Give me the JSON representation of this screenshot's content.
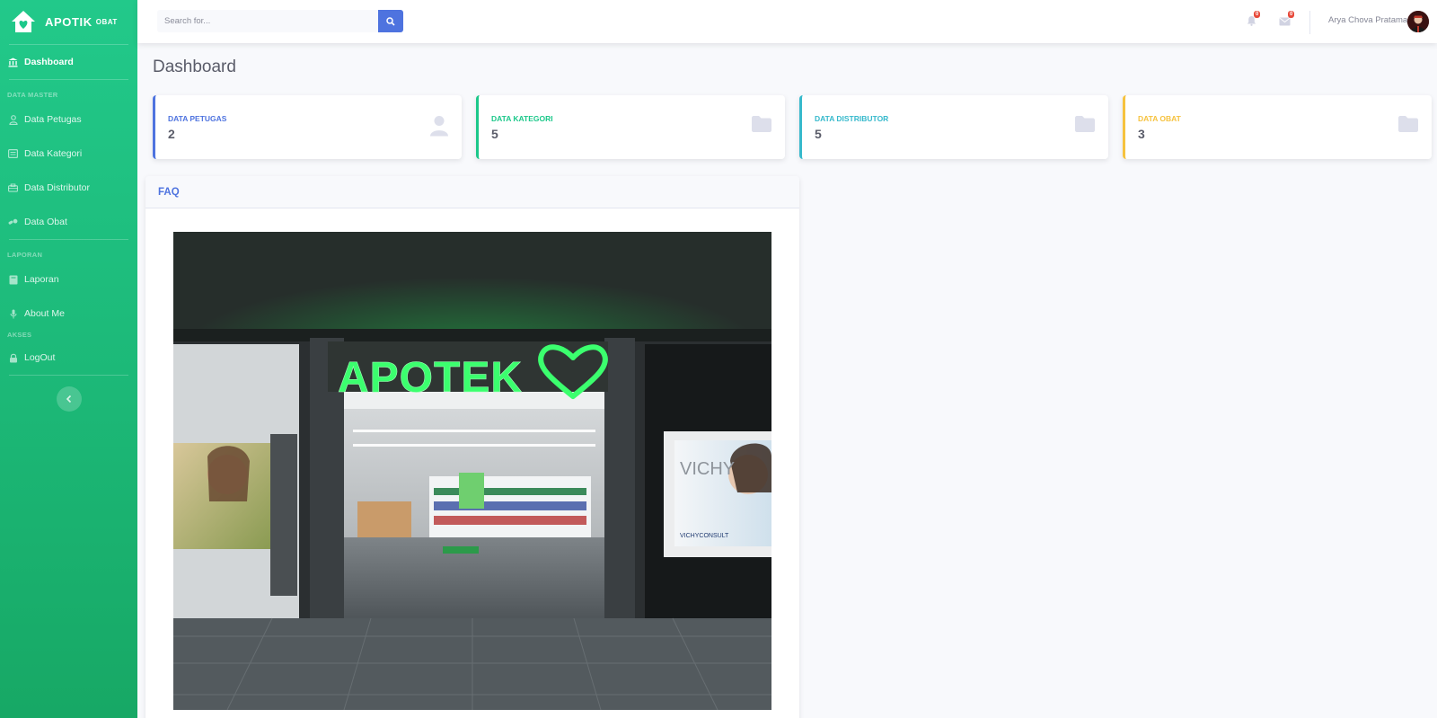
{
  "brand": {
    "name": "APOTIK",
    "sup": "OBAT"
  },
  "sidebar": {
    "dashboard": "Dashboard",
    "heading_master": "DATA MASTER",
    "petugas": "Data Petugas",
    "kategori": "Data Kategori",
    "distributor": "Data Distributor",
    "obat": "Data Obat",
    "heading_laporan": "LAPORAN",
    "laporan": "Laporan",
    "about": "About Me",
    "heading_akses": "AKSES",
    "logout": "LogOut"
  },
  "search": {
    "placeholder": "Search for..."
  },
  "topbar": {
    "alerts_count": "0",
    "messages_count": "0",
    "user_name": "Arya Chova Pratama"
  },
  "page": {
    "title": "Dashboard"
  },
  "cards": [
    {
      "label": "DATA PETUGAS",
      "value": "2",
      "color": "#4e73df",
      "icon": "user-icon"
    },
    {
      "label": "DATA KATEGORI",
      "value": "5",
      "color": "#1cc88a",
      "icon": "folder-icon"
    },
    {
      "label": "DATA DISTRIBUTOR",
      "value": "5",
      "color": "#36b9cc",
      "icon": "folder-icon"
    },
    {
      "label": "DATA OBAT",
      "value": "3",
      "color": "#f6c23e",
      "icon": "folder-icon"
    }
  ],
  "faq": {
    "title": "FAQ",
    "image": {
      "sign": "APOTEK",
      "poster_brand": "VICHY",
      "poster_sub": "VICHYCONSULT"
    }
  }
}
